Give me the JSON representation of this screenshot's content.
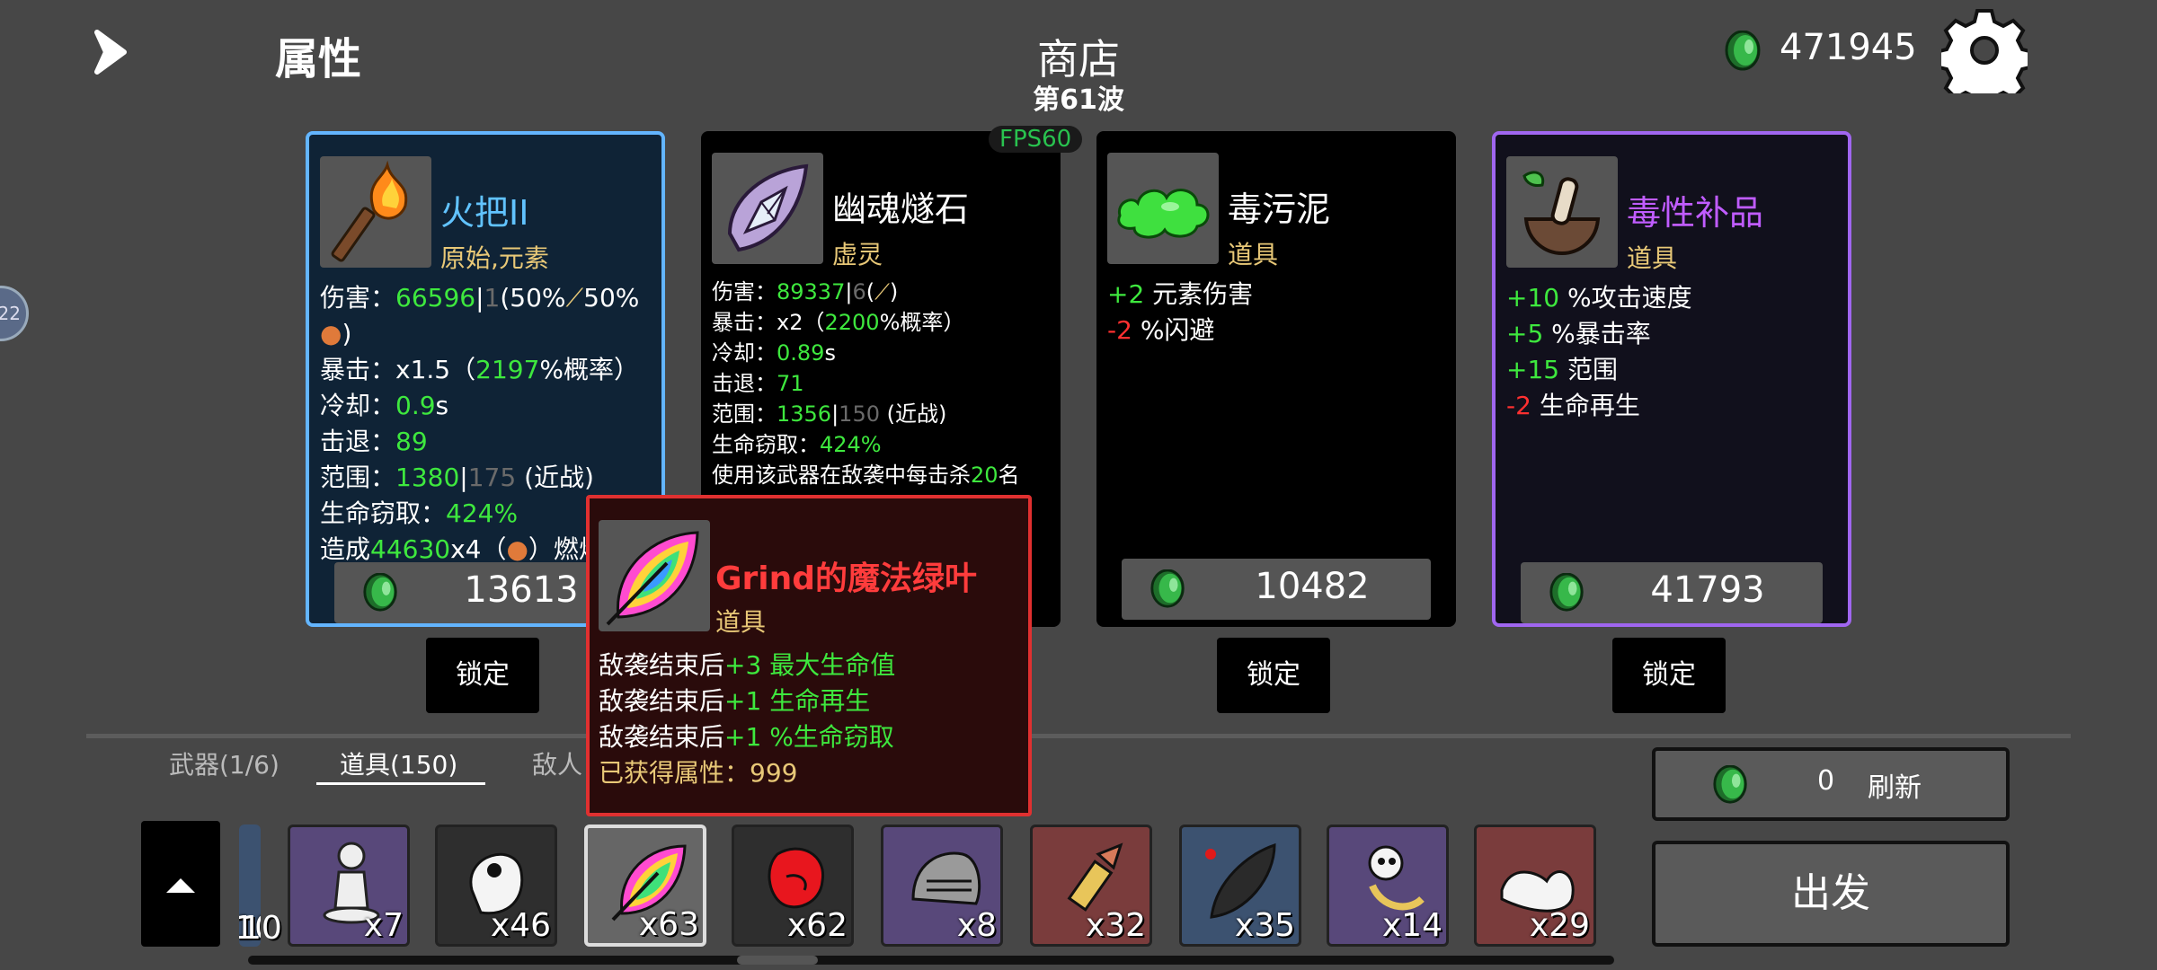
{
  "header": {
    "attributes_label": "属性",
    "shop_title": "商店",
    "wave": "第61波",
    "coin_total": "471945"
  },
  "side_bubble": "22",
  "fps": "FPS60",
  "cards": [
    {
      "name": "火把II",
      "type": "原始,元素",
      "icon": "torch-icon",
      "price": "13613",
      "lock": "锁定",
      "border_color": "#63b5ff",
      "stats": {
        "damage_label": "伤害：",
        "damage": "66596",
        "sep": "|",
        "base": "1",
        "scaling_open": "(50%",
        "scaling_mid": "50%",
        "scaling_close": ")",
        "crit_label": "暴击：",
        "crit_mult": "x1.5（",
        "crit_chance": "2197",
        "crit_tail": "%概率）",
        "cooldown_label": "冷却：",
        "cooldown": "0.9",
        "cooldown_unit": "s",
        "knockback_label": "击退：",
        "knockback": "89",
        "range_label": "范围：",
        "range": "1380",
        "range_base": "175",
        "range_tail": "(近战)",
        "lifesteal_label": "生命窃取：",
        "lifesteal": "424%",
        "burn_pre": "造成",
        "burn_value": "44630",
        "burn_mult": "x4（",
        "burn_tail": "）燃烧"
      }
    },
    {
      "name": "幽魂燧石",
      "type": "虚灵",
      "icon": "ghost-flint-icon",
      "stats": {
        "damage_label": "伤害：",
        "damage": "89337",
        "sep": "|",
        "base": "6",
        "scaling_tail": "(",
        "crit_label": "暴击：",
        "crit_mult": "x2（",
        "crit_chance": "2200",
        "crit_tail": "%概率）",
        "cooldown_label": "冷却：",
        "cooldown": "0.89",
        "cooldown_unit": "s",
        "knockback_label": "击退：",
        "knockback": "71",
        "range_label": "范围：",
        "range": "1356",
        "range_base": "150",
        "range_tail": "(近战)",
        "lifesteal_label": "生命窃取：",
        "lifesteal": "424%",
        "kill_pre": "使用该武器在敌袭中每击杀",
        "kill_value": "20",
        "kill_tail": "名"
      }
    },
    {
      "name": "毒污泥",
      "type": "道具",
      "icon": "slime-icon",
      "price": "10482",
      "lock": "锁定",
      "stats": [
        {
          "value": "+2",
          "label": " 元素伤害",
          "tone": "g"
        },
        {
          "value": "-2",
          "label": " %闪避",
          "tone": "r"
        }
      ]
    },
    {
      "name": "毒性补品",
      "type": "道具",
      "icon": "mortar-icon",
      "price": "41793",
      "lock": "锁定",
      "border_color": "#a066f0",
      "stats": [
        {
          "value": "+10",
          "label": " %攻击速度",
          "tone": "g"
        },
        {
          "value": "+5",
          "label": " %暴击率",
          "tone": "g"
        },
        {
          "value": "+15",
          "label": " 范围",
          "tone": "g"
        },
        {
          "value": "-2",
          "label": " 生命再生",
          "tone": "r"
        }
      ]
    }
  ],
  "tooltip": {
    "name": "Grind的魔法绿叶",
    "type": "道具",
    "icon": "rainbow-leaf-icon",
    "lines": [
      {
        "pre": "敌袭结束后",
        "value": "+3 最大生命值"
      },
      {
        "pre": "敌袭结束后",
        "value": "+1 生命再生"
      },
      {
        "pre": "敌袭结束后",
        "value": "+1 %生命窃取"
      }
    ],
    "gained_label": "已获得属性：",
    "gained_value": "999",
    "border_color": "#e03030"
  },
  "tabs": [
    {
      "label": "武器(1/6)"
    },
    {
      "label": "道具(150)",
      "active": true
    },
    {
      "label": "敌人"
    }
  ],
  "refresh": {
    "cost": "0",
    "label": "刷新"
  },
  "go_label": "出发",
  "inventory": [
    {
      "count": "10",
      "icon": "partial-item-icon"
    },
    {
      "count": "x7",
      "icon": "statue-icon"
    },
    {
      "count": "x46",
      "icon": "ghost-creature-icon"
    },
    {
      "count": "x63",
      "icon": "rainbow-leaf-icon"
    },
    {
      "count": "x62",
      "icon": "boxing-glove-icon"
    },
    {
      "count": "x8",
      "icon": "knight-helmet-icon"
    },
    {
      "count": "x32",
      "icon": "bullet-icon"
    },
    {
      "count": "x35",
      "icon": "leech-icon"
    },
    {
      "count": "x14",
      "icon": "skull-creature-icon"
    },
    {
      "count": "x29",
      "icon": "muscle-arm-icon"
    }
  ]
}
